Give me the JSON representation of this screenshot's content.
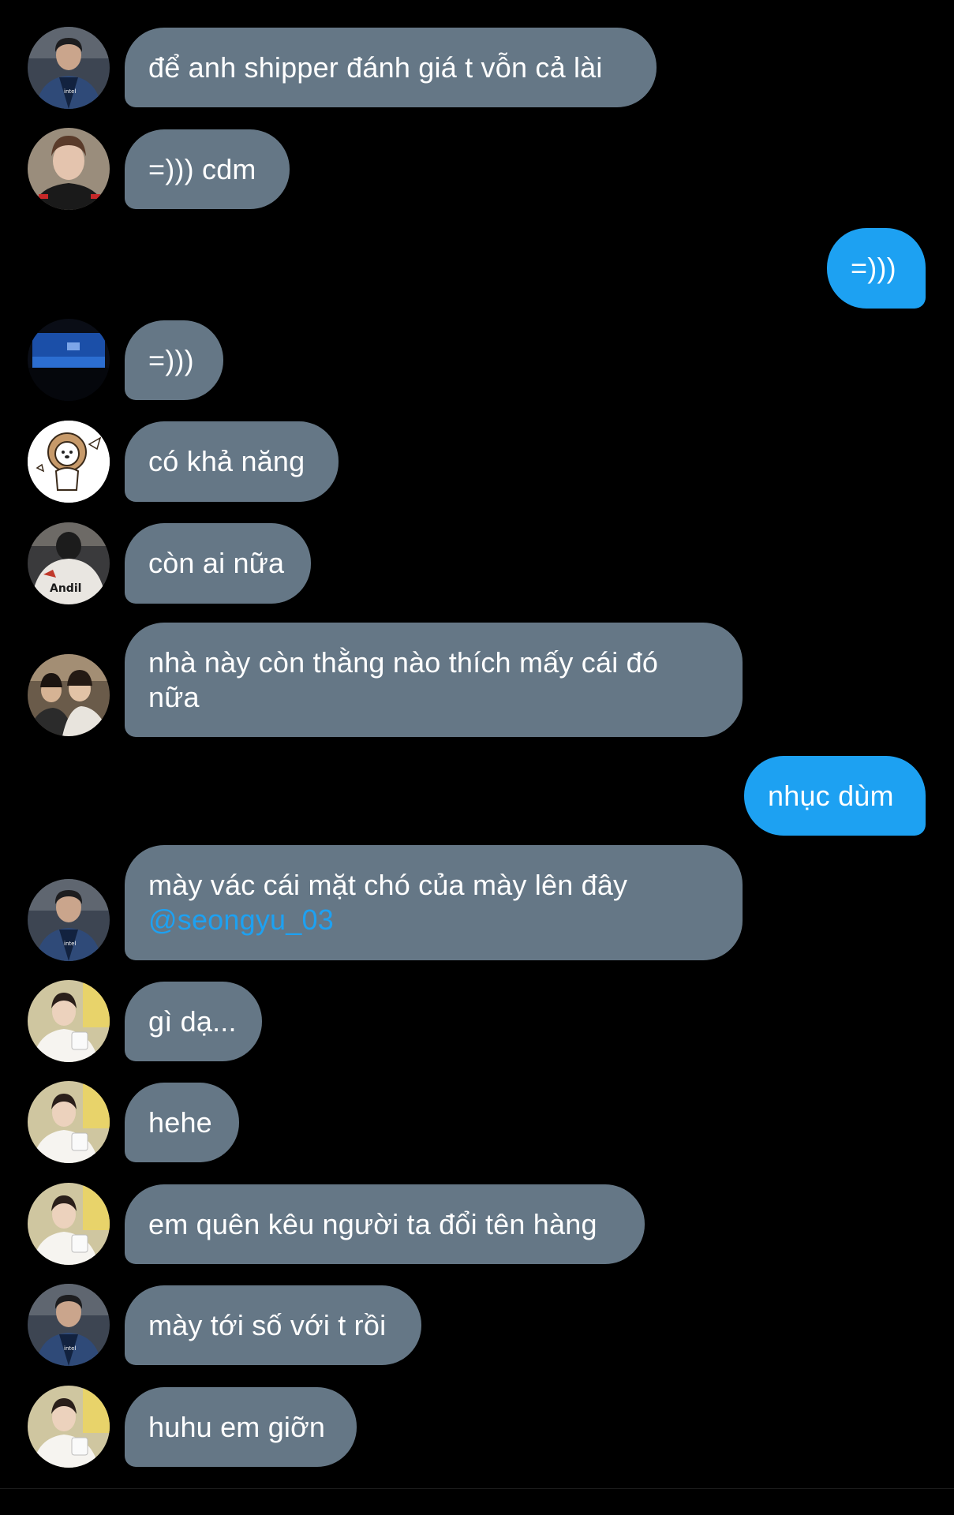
{
  "colors": {
    "background": "#000000",
    "incoming_bubble": "#657786",
    "outgoing_bubble": "#1DA1F2",
    "mention": "#1DA1F2",
    "text": "#FFFFFF"
  },
  "messages": [
    {
      "direction": "incoming",
      "avatar": "user-a",
      "text": "để anh shipper đánh giá t vỗn cả lài"
    },
    {
      "direction": "incoming",
      "avatar": "user-b",
      "text": "=))) cdm"
    },
    {
      "direction": "outgoing",
      "text": "=)))"
    },
    {
      "direction": "incoming",
      "avatar": "user-c",
      "text": "=)))"
    },
    {
      "direction": "incoming",
      "avatar": "user-d",
      "text": "có khả năng"
    },
    {
      "direction": "incoming",
      "avatar": "user-e",
      "text": "còn ai nữa"
    },
    {
      "direction": "incoming",
      "avatar": "user-f",
      "text": "nhà này còn thằng nào thích mấy cái đó",
      "text_line2": "nữa"
    },
    {
      "direction": "outgoing",
      "text": "nhục dùm"
    },
    {
      "direction": "incoming",
      "avatar": "user-a",
      "text": "mày vác cái mặt chó của mày lên đây",
      "mention": "@seongyu_03"
    },
    {
      "direction": "incoming",
      "avatar": "user-g",
      "text": "gì dạ..."
    },
    {
      "direction": "incoming",
      "avatar": "user-g",
      "text": "hehe"
    },
    {
      "direction": "incoming",
      "avatar": "user-g",
      "text": "em quên kêu người ta đổi tên hàng"
    },
    {
      "direction": "incoming",
      "avatar": "user-a",
      "text": "mày tới số với t rồi"
    },
    {
      "direction": "incoming",
      "avatar": "user-g",
      "text": "huhu em giỡn"
    }
  ],
  "avatar_icons": {
    "user-a": "avatar-photo-jacket-icon",
    "user-b": "avatar-photo-face-icon",
    "user-c": "avatar-photo-screen-icon",
    "user-d": "avatar-lion-drawing-icon",
    "user-e": "avatar-photo-jersey-icon",
    "user-f": "avatar-photo-group-icon",
    "user-g": "avatar-photo-white-shirt-icon"
  },
  "avatar_texts": {
    "user-a": "intel",
    "user-e": "Andil"
  }
}
